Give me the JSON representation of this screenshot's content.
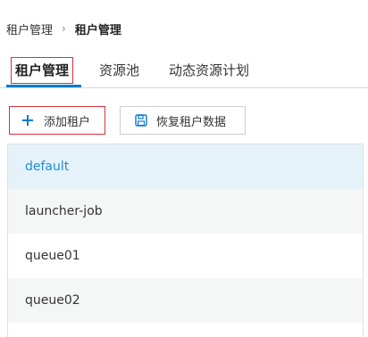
{
  "breadcrumb": {
    "parent": "租户管理",
    "separator": "›",
    "current": "租户管理"
  },
  "tabs": [
    {
      "label": "租户管理",
      "active": true
    },
    {
      "label": "资源池",
      "active": false
    },
    {
      "label": "动态资源计划",
      "active": false
    }
  ],
  "actions": {
    "add_label": "添加租户",
    "restore_label": "恢复租户数据"
  },
  "icons": {
    "add": "plus-icon",
    "restore": "save-icon"
  },
  "colors": {
    "accent": "#0c7bd1",
    "highlight_border": "#d8313a",
    "selected_bg": "#e6f2fa",
    "selected_text": "#1a8fd6"
  },
  "queues": [
    {
      "name": "default",
      "selected": true
    },
    {
      "name": "launcher-job",
      "selected": false
    },
    {
      "name": "queue01",
      "selected": false
    },
    {
      "name": "queue02",
      "selected": false
    }
  ]
}
